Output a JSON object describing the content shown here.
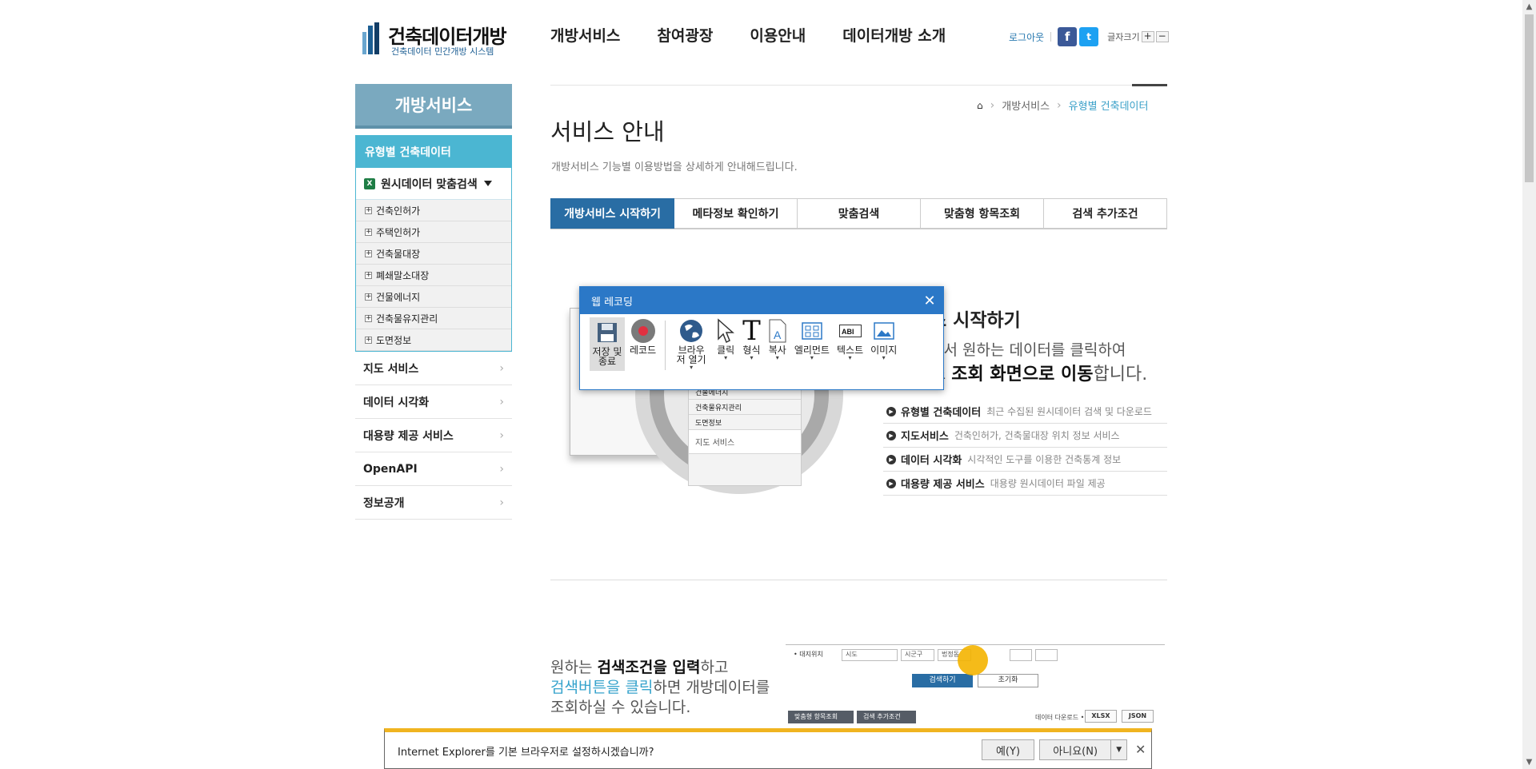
{
  "header": {
    "logo_title": "건축데이터개방",
    "logo_sub": "건축데이터 민간개방 시스템",
    "gnb": [
      "개방서비스",
      "참여광장",
      "이용안내",
      "데이터개방 소개"
    ],
    "logout": "로그아웃",
    "font_size_label": "글자크기",
    "font_plus": "+",
    "font_minus": "−"
  },
  "lnb": {
    "title": "개방서비스",
    "active_group": "유형별 건축데이터",
    "active_sub": "원시데이터 맞춤검색",
    "sub_items": [
      "건축인허가",
      "주택인허가",
      "건축물대장",
      "폐쇄말소대장",
      "건물에너지",
      "건축물유지관리",
      "도면정보"
    ],
    "menu": [
      "지도 서비스",
      "데이터 시각화",
      "대용량 제공 서비스",
      "OpenAPI",
      "정보공개"
    ]
  },
  "breadcrumb": {
    "level1": "개방서비스",
    "level2": "유형별 건축데이터"
  },
  "page": {
    "title": "서비스 안내",
    "desc": "개방서비스 기능별 이용방법을 상세하게 안내해드립니다."
  },
  "tabs": [
    "개방서비스 시작하기",
    "메타정보 확인하기",
    "맞춤검색",
    "맞춤형 항목조회",
    "검색 추가조건"
  ],
  "intro": {
    "title": "스 시작하기",
    "line1": "에서 원하는 데이터를 클릭하여",
    "line2_pre": "스 ",
    "line2_bold": "조회 화면으로 이동",
    "line2_post": "합니다."
  },
  "illustration": {
    "items": [
      "건물에너지",
      "건축물유지관리",
      "도면정보"
    ],
    "map_service": "지도 서비스"
  },
  "features": [
    {
      "name": "유형별 건축데이터",
      "desc": "최근 수집된 원시데이터 검색 및 다운로드"
    },
    {
      "name": "지도서비스",
      "desc": "건축인허가, 건축물대장 위치 정보 서비스"
    },
    {
      "name": "데이터 시각화",
      "desc": "시각적인 도구를 이용한 건축통계 정보"
    },
    {
      "name": "대용량 제공 서비스",
      "desc": "대용량 원시데이터 파일 제공"
    }
  ],
  "section2": {
    "l1_pre": "원하는 ",
    "l1_bold": "검색조건을 입력",
    "l1_post": "하고",
    "l2_blue": "검색버튼을 클릭",
    "l2_post": "하면 개방데이터를",
    "l3": "조회하실 수 있습니다."
  },
  "search_shot": {
    "location": "• 대지위치",
    "sido": "시도",
    "sigungu": "시군구",
    "bjd": "법정동",
    "search": "검색하기",
    "reset": "초기화",
    "tab1": "맞춤형 항목조회",
    "tab2": "검색 추가조건",
    "download": "데이터 다운로드 •",
    "xlsx": "XLSX",
    "json": "JSON"
  },
  "recorder": {
    "title": "웹 레코딩",
    "tools": [
      "저장 및 종료",
      "레코드",
      "브라우저 열기",
      "클릭",
      "형식",
      "복사",
      "엘리먼트",
      "텍스트",
      "이미지"
    ]
  },
  "ie_bar": {
    "message": "Internet Explorer를 기본 브라우저로 설정하시겠습니까?",
    "yes": "예(Y)",
    "no": "아니요(N)"
  },
  "colors": {
    "primary": "#296da4",
    "accent": "#4bb6d2",
    "lnb_title": "#7aa9bf",
    "recorder": "#2b78c7",
    "ie_bar": "#f0b420"
  }
}
